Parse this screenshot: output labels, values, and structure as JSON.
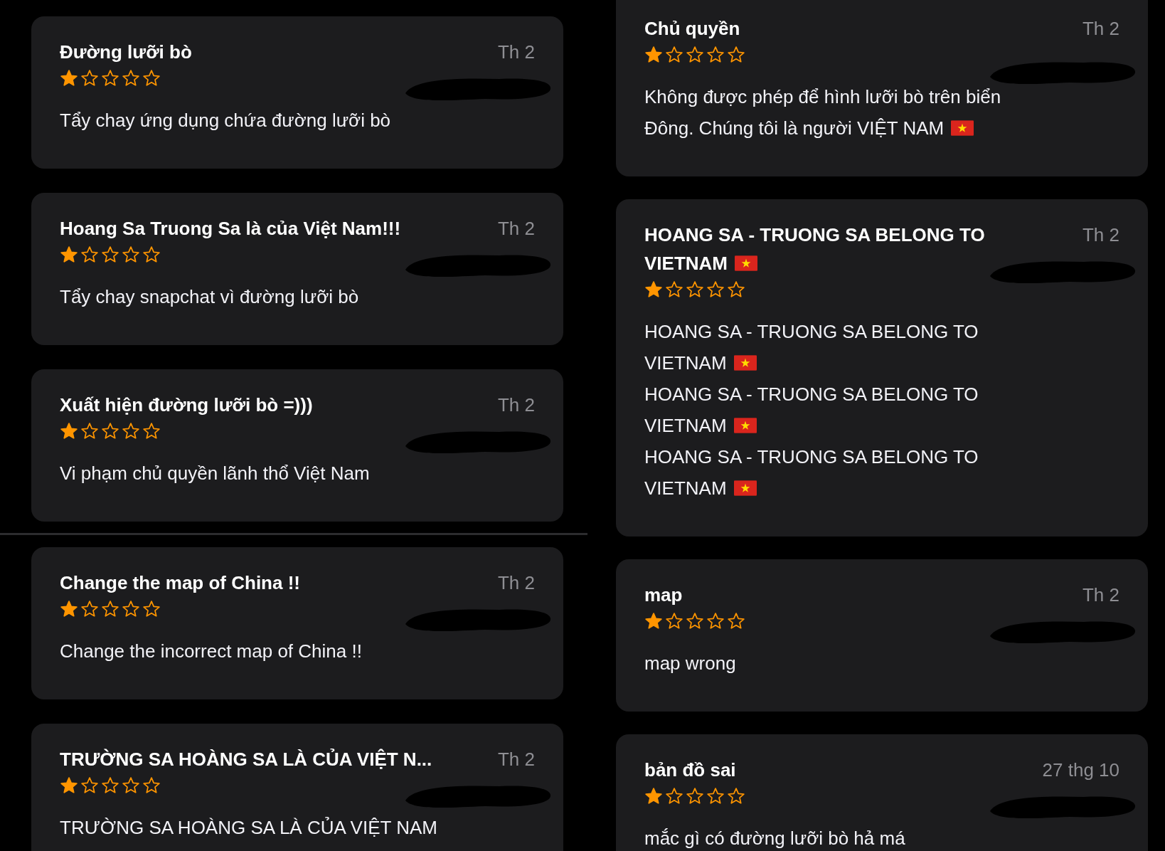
{
  "columns": [
    {
      "reviews": [
        {
          "title": "Đường lưỡi bò",
          "title_flag": false,
          "date": "Th 2",
          "stars": 1,
          "body": [
            {
              "text": "Tẩy chay ứng dụng chứa đường lưỡi bò",
              "flag": false
            }
          ]
        },
        {
          "title": "Hoang Sa Truong Sa là của Việt Nam!!!",
          "title_flag": false,
          "date": "Th 2",
          "stars": 1,
          "body": [
            {
              "text": "Tẩy chay snapchat vì đường lưỡi bò",
              "flag": false
            }
          ]
        },
        {
          "title": "Xuất hiện đường lưỡi bò =)))",
          "title_flag": false,
          "date": "Th 2",
          "stars": 1,
          "body": [
            {
              "text": "Vi phạm chủ quyền lãnh thổ Việt Nam",
              "flag": false
            }
          ]
        },
        {
          "title": "Change the map of China !!",
          "title_flag": false,
          "date": "Th 2",
          "stars": 1,
          "body": [
            {
              "text": "Change the incorrect map of China !!",
              "flag": false
            }
          ]
        },
        {
          "title": "TRƯỜNG SA HOÀNG SA LÀ CỦA VIỆT N...",
          "title_flag": false,
          "date": "Th 2",
          "stars": 1,
          "body": [
            {
              "text": "TRƯỜNG SA HOÀNG SA LÀ CỦA VIỆT NAM",
              "flag": false
            }
          ]
        }
      ]
    },
    {
      "reviews": [
        {
          "title": "Chủ quyền",
          "title_flag": false,
          "date": "Th 2",
          "stars": 1,
          "body": [
            {
              "text": "Không được phép để hình lưỡi bò trên biển Đông. Chúng tôi là người VIỆT NAM",
              "flag": true
            }
          ]
        },
        {
          "title": "HOANG SA - TRUONG SA BELONG TO VIETNAM",
          "title_flag": true,
          "date": "Th 2",
          "stars": 1,
          "body": [
            {
              "text": "HOANG SA - TRUONG SA BELONG TO VIETNAM",
              "flag": true
            },
            {
              "text": "HOANG SA - TRUONG SA BELONG TO VIETNAM",
              "flag": true
            },
            {
              "text": "HOANG SA - TRUONG SA BELONG TO VIETNAM",
              "flag": true
            }
          ]
        },
        {
          "title": "map",
          "title_flag": false,
          "date": "Th 2",
          "stars": 1,
          "body": [
            {
              "text": "map wrong",
              "flag": false
            }
          ]
        },
        {
          "title": "bản đồ sai",
          "title_flag": false,
          "date": "27 thg 10",
          "stars": 1,
          "body": [
            {
              "text": "mắc gì có đường lưỡi bò hả má",
              "flag": false
            }
          ]
        }
      ]
    }
  ]
}
